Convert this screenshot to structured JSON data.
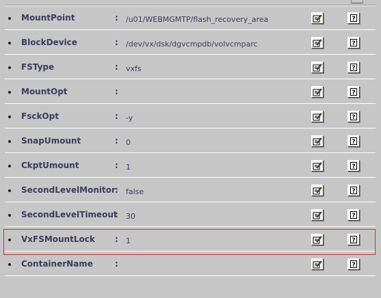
{
  "attributes": [
    {
      "name": "MountPoint",
      "value": "/u01/WEBMGMTP/flash_recovery_area"
    },
    {
      "name": "BlockDevice",
      "value": "/dev/vx/dsk/dgvcmpdb/volvcmparc"
    },
    {
      "name": "FSType",
      "value": "vxfs"
    },
    {
      "name": "MountOpt",
      "value": ""
    },
    {
      "name": "FsckOpt",
      "value": "-y"
    },
    {
      "name": "SnapUmount",
      "value": "0"
    },
    {
      "name": "CkptUmount",
      "value": "1"
    },
    {
      "name": "SecondLevelMonitor",
      "value": "false"
    },
    {
      "name": "SecondLevelTimeout",
      "value": "30"
    },
    {
      "name": "VxFSMountLock",
      "value": "1"
    },
    {
      "name": "ContainerName",
      "value": ""
    }
  ],
  "separator": ":",
  "icons": {
    "edit": "edit-icon",
    "help": "help-icon"
  },
  "colors": {
    "background": "#c6c6c6",
    "text": "#3b3b5e",
    "highlight": "#d03030"
  },
  "highlighted_row": "VxFSMountLock"
}
